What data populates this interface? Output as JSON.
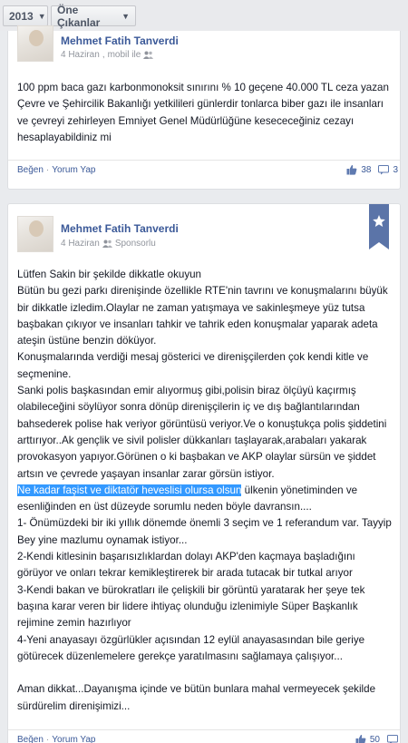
{
  "filters": {
    "year": "2013",
    "featured": "Öne Çıkanlar"
  },
  "colors": {
    "link": "#3b5998",
    "highlight": "#3399ff",
    "featured_ribbon": "#5b74a8"
  },
  "posts": [
    {
      "author": "Mehmet Fatih Tanverdi",
      "time": "4 Haziran",
      "source": "mobil ile",
      "audience_icon": "friends-icon",
      "paragraphs": [
        "100 ppm baca gazı karbonmonoksit sınırını % 10 geçene 40.000 TL ceza yazan Çevre ve Şehircilik Bakanlığı yetkilileri günlerdir tonlarca biber gazı ile insanları ve çevreyi zehirleyen Emniyet Genel Müdürlüğüne kesececeğiniz cezayı hesaplayabildiniz mi"
      ],
      "like_label": "Beğen",
      "comment_label": "Yorum Yap",
      "likes": "38",
      "comments": "3"
    },
    {
      "author": "Mehmet Fatih Tanverdi",
      "time": "4 Haziran",
      "source": "Sponsorlu",
      "audience_icon": "friends-icon",
      "featured_icon": "star-icon",
      "paragraphs": [
        "Lütfen Sakin bir şekilde dikkatle okuyun",
        "Bütün bu gezi parkı direnişinde özellikle RTE'nin tavrını ve konuşmalarını büyük bir dikkatle izledim.Olaylar ne zaman yatışmaya ve sakinleşmeye yüz tutsa başbakan çıkıyor ve insanları tahkir ve tahrik eden konuşmalar yaparak adeta ateşin üstüne benzin döküyor.",
        "Konuşmalarında verdiği mesaj gösterici ve direnişçilerden çok kendi kitle ve seçmenine.",
        "Sanki polis başkasından emir alıyormuş gibi,polisin biraz ölçüyü kaçırmış olabileceğini söylüyor sonra dönüp direnişçilerin iç ve dış bağlantılarından bahsederek polise hak veriyor görüntüsü veriyor.Ve o konuştukça polis şiddetini arttırıyor..Ak gençlik ve sivil polisler dükkanları taşlayarak,arabaları yakarak provokasyon yapıyor.Görünen o ki başbakan ve AKP olaylar sürsün ve şiddet artsın ve çevrede yaşayan insanlar zarar görsün istiyor."
      ],
      "highlight_text": "Ne kadar faşist ve diktatör heveslisi olursa olsun",
      "highlight_rest": " ülkenin yönetiminden ve esenliğinden en üst düzeyde sorumlu neden böyle davransın....",
      "paragraphs_after": [
        "1- Önümüzdeki bir iki yıllık dönemde önemli 3 seçim ve 1 referandum var. Tayyip Bey yine mazlumu oynamak istiyor...",
        "2-Kendi kitlesinin başarısızlıklardan dolayı AKP'den kaçmaya başladığını görüyor ve onları tekrar kemikleştirerek bir arada tutacak bir tutkal arıyor",
        "3-Kendi bakan ve bürokratları ile çelişkili bir görüntü yaratarak her şeye tek başına karar veren bir lidere ihtiyaç olunduğu izlenimiyle Süper Başkanlık rejimine zemin hazırlıyor",
        "4-Yeni anayasayı özgürlükler açısından 12 eylül anayasasından bile geriye götürecek düzenlemelere gerekçe yaratılmasını sağlamaya çalışıyor...",
        "",
        "Aman dikkat...Dayanışma içinde ve bütün bunlara mahal vermeyecek şekilde sürdürelim direnişimizi..."
      ],
      "like_label": "Beğen",
      "comment_label": "Yorum Yap",
      "likes": "50",
      "comments": ""
    }
  ]
}
